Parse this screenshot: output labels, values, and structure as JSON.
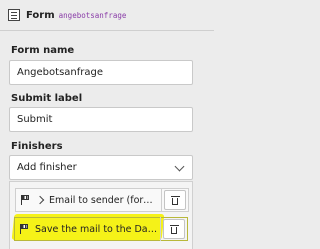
{
  "header": {
    "title": "Form",
    "identifier": "angebotsanfrage"
  },
  "form_name": {
    "label": "Form name",
    "value": "Angebotsanfrage"
  },
  "submit_label": {
    "label": "Submit label",
    "value": "Submit"
  },
  "finishers": {
    "label": "Finishers",
    "add_select": "Add finisher",
    "items": [
      {
        "label": "Email to sender (form submi…"
      },
      {
        "label": "Save the mail to the Database"
      }
    ]
  },
  "colors": {
    "highlight": "#f5f200",
    "identifier": "#8a3da8"
  }
}
